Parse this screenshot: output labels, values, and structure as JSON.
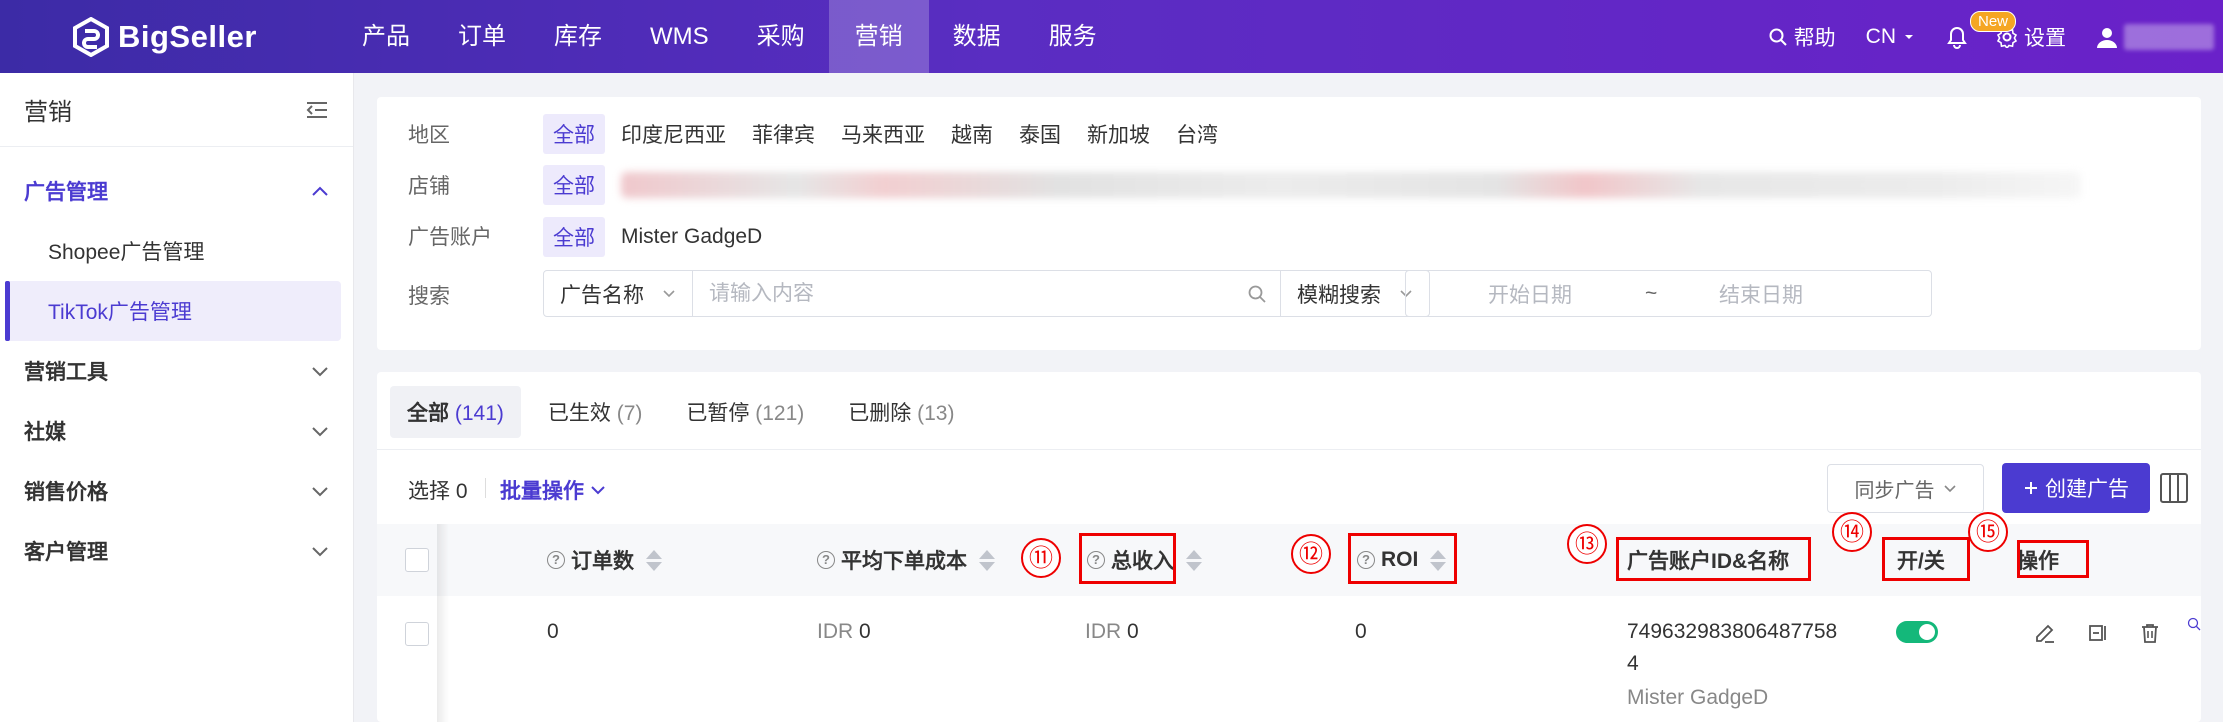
{
  "brand": {
    "name": "BigSeller"
  },
  "nav": {
    "items": [
      "产品",
      "订单",
      "库存",
      "WMS",
      "采购",
      "营销",
      "数据",
      "服务"
    ],
    "active_index": 5
  },
  "topright": {
    "help": "帮助",
    "lang": "CN",
    "new_badge": "New",
    "settings": "设置"
  },
  "sidebar": {
    "title": "营销",
    "groups": [
      {
        "label": "广告管理",
        "open": true,
        "items": [
          "Shopee广告管理",
          "TikTok广告管理"
        ],
        "active_item": 1
      },
      {
        "label": "营销工具",
        "open": false
      },
      {
        "label": "社媒",
        "open": false
      },
      {
        "label": "销售价格",
        "open": false
      },
      {
        "label": "客户管理",
        "open": false
      }
    ]
  },
  "filters": {
    "region": {
      "label": "地区",
      "options": [
        "全部",
        "印度尼西亚",
        "菲律宾",
        "马来西亚",
        "越南",
        "泰国",
        "新加坡",
        "台湾"
      ],
      "selected": 0
    },
    "store": {
      "label": "店铺",
      "options": [
        "全部"
      ],
      "selected": 0
    },
    "ad_account": {
      "label": "广告账户",
      "options": [
        "全部",
        "Mister GadgeD"
      ],
      "selected": 0
    },
    "search": {
      "label": "搜索",
      "field": "广告名称",
      "placeholder": "请输入内容",
      "mode": "模糊搜索",
      "start_placeholder": "开始日期",
      "range_sep": "~",
      "end_placeholder": "结束日期"
    }
  },
  "tabs": [
    {
      "label": "全部",
      "count": "(141)",
      "active": true
    },
    {
      "label": "已生效",
      "count": "(7)"
    },
    {
      "label": "已暂停",
      "count": "(121)"
    },
    {
      "label": "已删除",
      "count": "(13)"
    }
  ],
  "toolbar": {
    "select_label": "选择 0",
    "batch_label": "批量操作",
    "sync_label": "同步广告",
    "create_label": "创建广告"
  },
  "table": {
    "columns": {
      "orders": "订单数",
      "avg_cost": "平均下单成本",
      "revenue": "总收入",
      "roi": "ROI",
      "account": "广告账户ID&名称",
      "toggle": "开/关",
      "actions": "操作"
    },
    "rows": [
      {
        "orders": "0",
        "avg_cost_currency": "IDR",
        "avg_cost": "0",
        "revenue_currency": "IDR",
        "revenue": "0",
        "roi": "0",
        "account_id_line1": "749632983806487758",
        "account_id_line2": "4",
        "account_name": "Mister GadgeD",
        "enabled": true
      }
    ]
  },
  "annotations": {
    "markers": [
      "⑪",
      "⑫",
      "⑬",
      "⑭",
      "⑮"
    ],
    "color": "#e00000"
  },
  "colors": {
    "accent": "#4b3bd1",
    "topbar_start": "#3c2ba6",
    "topbar_end": "#6a21c9",
    "toggle_on": "#14b87a"
  }
}
